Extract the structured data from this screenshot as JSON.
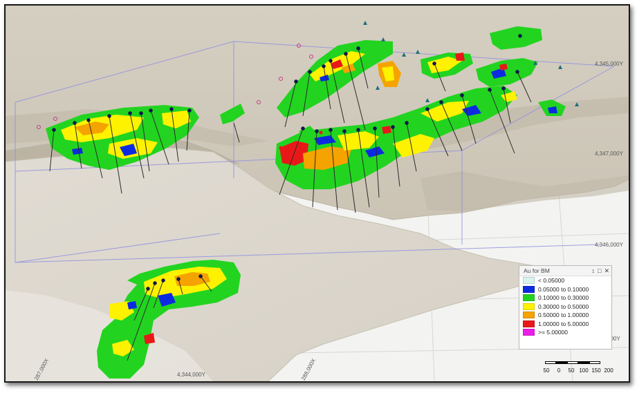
{
  "legend": {
    "title": "Au for BM",
    "controls": {
      "pin": "↕",
      "restore": "□",
      "close": "✕"
    },
    "items": [
      {
        "label": "< 0.05000",
        "color": "#d8f3ef"
      },
      {
        "label": "0.05000 to 0.10000",
        "color": "#0c2be0"
      },
      {
        "label": "0.10000 to 0.30000",
        "color": "#22d420"
      },
      {
        "label": "0.30000 to 0.50000",
        "color": "#fff200"
      },
      {
        "label": "0.50000 to 1.00000",
        "color": "#f5a300"
      },
      {
        "label": "1.00000 to 5.00000",
        "color": "#e91818"
      },
      {
        "label": ">= 5.00000",
        "color": "#ea1ee8"
      }
    ]
  },
  "coordinates": {
    "y_4345000": "4,345,000Y",
    "y_4347000": "4,347,000Y",
    "y_4346000": "4,346,000Y",
    "y_edge": "000Y",
    "x_287000": "287,000X",
    "x_4344000": "4,344,000Y",
    "x_288000": "288,000X"
  },
  "scalebar": {
    "labels": [
      "50",
      "0",
      "50",
      "100",
      "150",
      "200"
    ]
  },
  "colors": {
    "terrain": "#c9c2b3",
    "terrain_light": "#ddd8cc",
    "drillhole_collar": "#0d1560",
    "gridline": "#7d7dd6"
  }
}
